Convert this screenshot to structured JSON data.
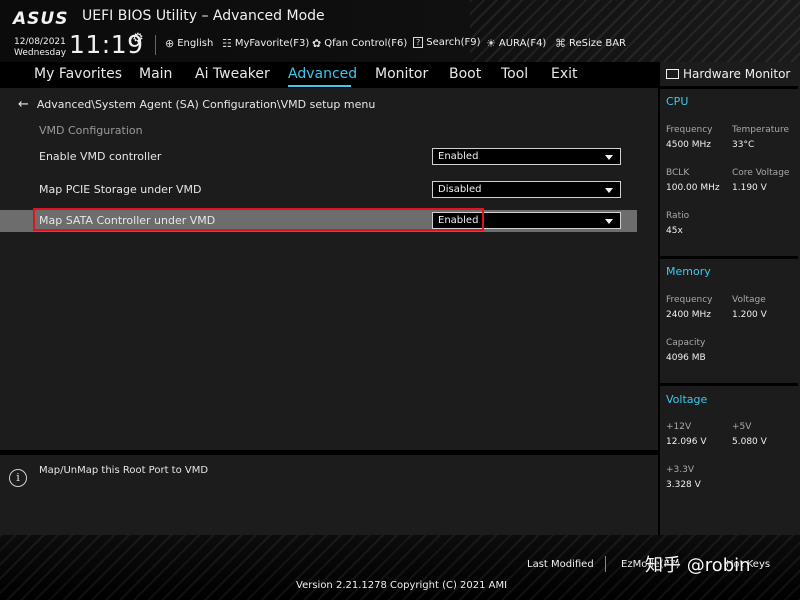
{
  "header": {
    "logo": "ASUS",
    "title": "UEFI BIOS Utility – Advanced Mode",
    "date": "12/08/2021",
    "weekday": "Wednesday",
    "time": "11:19",
    "toolbar": [
      {
        "icon": "globe-icon",
        "glyph": "⊕",
        "label": "English"
      },
      {
        "icon": "myfavorite-icon",
        "glyph": "☷",
        "label": "MyFavorite(F3)"
      },
      {
        "icon": "fan-icon",
        "glyph": "✿",
        "label": "Qfan Control(F6)"
      },
      {
        "icon": "search-icon",
        "glyph": "?",
        "label": "Search(F9)"
      },
      {
        "icon": "aura-icon",
        "glyph": "☀",
        "label": "AURA(F4)"
      },
      {
        "icon": "resize-bar-icon",
        "glyph": "⌘",
        "label": "ReSize BAR"
      }
    ]
  },
  "menu": {
    "items": [
      "My Favorites",
      "Main",
      "Ai Tweaker",
      "Advanced",
      "Monitor",
      "Boot",
      "Tool",
      "Exit"
    ],
    "active": "Advanced"
  },
  "main": {
    "breadcrumb": "Advanced\\System Agent (SA) Configuration\\VMD setup menu",
    "section_label": "VMD Configuration",
    "settings": [
      {
        "label": "Enable VMD controller",
        "value": "Enabled"
      },
      {
        "label": "Map PCIE Storage under VMD",
        "value": "Disabled"
      },
      {
        "label": "Map SATA Controller under VMD",
        "value": "Enabled"
      }
    ]
  },
  "info": {
    "text": "Map/UnMap this Root Port to VMD"
  },
  "hardware_monitor": {
    "title": "Hardware Monitor",
    "cpu": {
      "heading": "CPU",
      "frequency_label": "Frequency",
      "frequency": "4500 MHz",
      "temperature_label": "Temperature",
      "temperature": "33°C",
      "bclk_label": "BCLK",
      "bclk": "100.00 MHz",
      "core_voltage_label": "Core Voltage",
      "core_voltage": "1.190 V",
      "ratio_label": "Ratio",
      "ratio": "45x"
    },
    "memory": {
      "heading": "Memory",
      "frequency_label": "Frequency",
      "frequency": "2400 MHz",
      "voltage_label": "Voltage",
      "voltage": "1.200 V",
      "capacity_label": "Capacity",
      "capacity": "4096 MB"
    },
    "voltage": {
      "heading": "Voltage",
      "v12_label": "+12V",
      "v12": "12.096 V",
      "v5_label": "+5V",
      "v5": "5.080 V",
      "v33_label": "+3.3V",
      "v33": "3.328 V"
    }
  },
  "footer": {
    "last_modified": "Last Modified",
    "ezmode": "EzMode(F7)",
    "hotkeys": "Hot Keys",
    "copyright": "Version 2.21.1278 Copyright (C) 2021 AMI",
    "watermark": "知乎 @robin"
  },
  "colors": {
    "accent": "#3cc8f0",
    "highlight_box": "#e0141e",
    "selected_row": "#6d6d6d",
    "panel": "#1c1c1c"
  }
}
